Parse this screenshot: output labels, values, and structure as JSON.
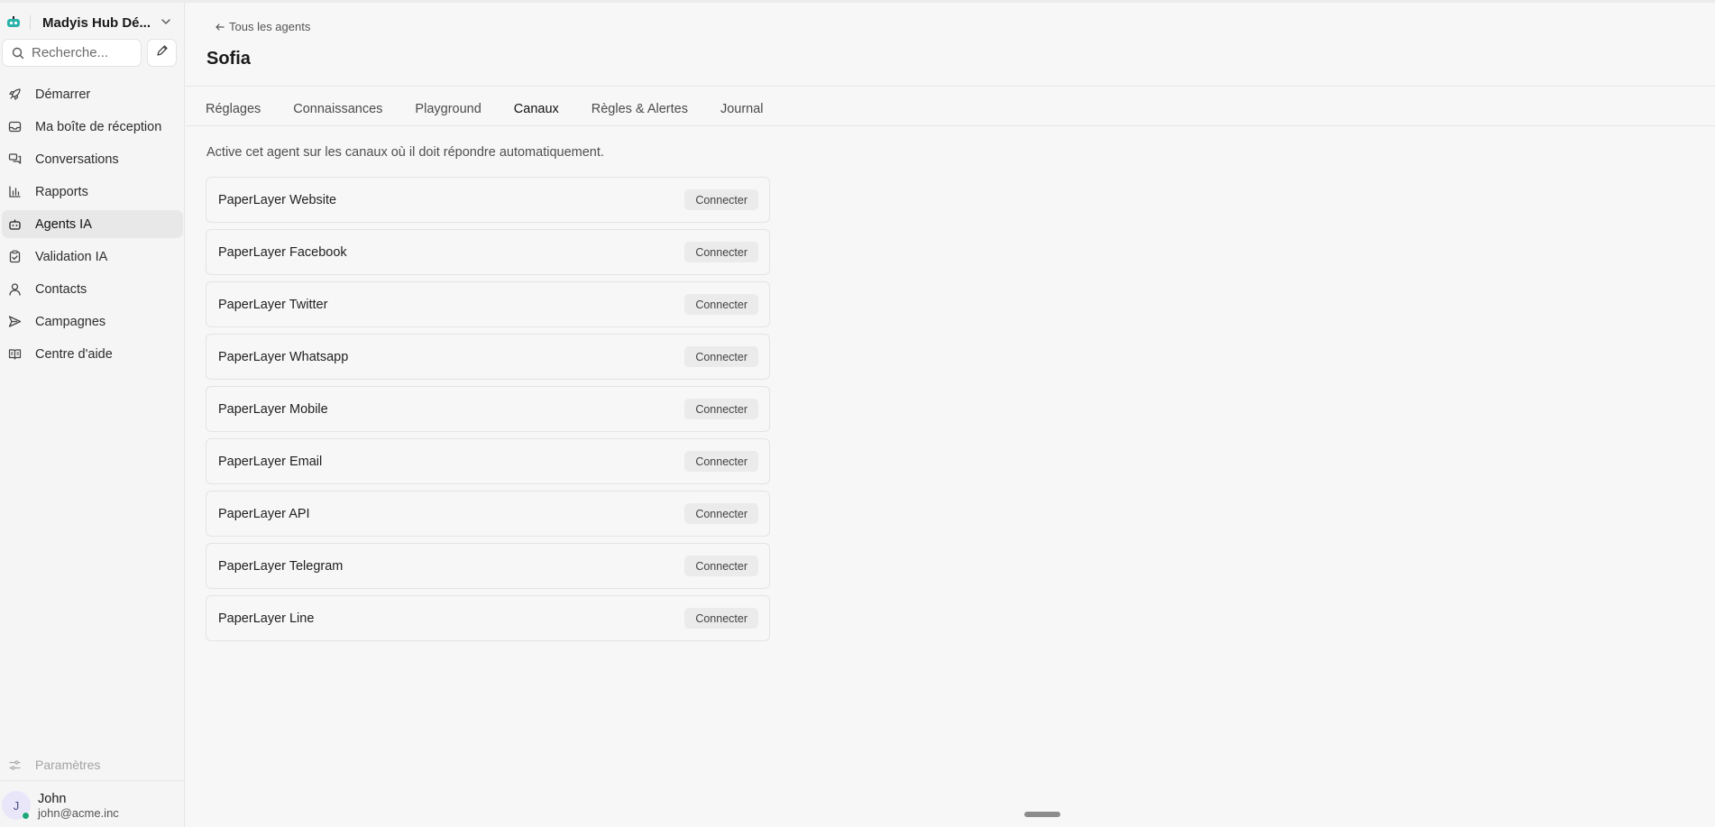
{
  "workspace": {
    "name": "Madyis Hub Dé..."
  },
  "search": {
    "placeholder": "Recherche..."
  },
  "sidebar": {
    "items": [
      {
        "label": "Démarrer",
        "icon": "rocket-icon"
      },
      {
        "label": "Ma boîte de réception",
        "icon": "inbox-icon"
      },
      {
        "label": "Conversations",
        "icon": "chat-icon"
      },
      {
        "label": "Rapports",
        "icon": "bar-chart-icon"
      },
      {
        "label": "Agents IA",
        "icon": "bot-icon",
        "active": true
      },
      {
        "label": "Validation IA",
        "icon": "clipboard-check-icon"
      },
      {
        "label": "Contacts",
        "icon": "user-icon"
      },
      {
        "label": "Campagnes",
        "icon": "send-icon"
      },
      {
        "label": "Centre d'aide",
        "icon": "book-icon"
      }
    ],
    "settings_label": "Paramètres"
  },
  "user": {
    "initial": "J",
    "name": "John",
    "email": "john@acme.inc"
  },
  "header": {
    "back_label": "Tous les agents",
    "title": "Sofia"
  },
  "tabs": [
    {
      "label": "Réglages"
    },
    {
      "label": "Connaissances"
    },
    {
      "label": "Playground"
    },
    {
      "label": "Canaux",
      "active": true
    },
    {
      "label": "Règles & Alertes"
    },
    {
      "label": "Journal"
    }
  ],
  "description": "Active cet agent sur les canaux où il doit répondre automatiquement.",
  "channels": [
    {
      "name": "PaperLayer Website",
      "action": "Connecter"
    },
    {
      "name": "PaperLayer Facebook",
      "action": "Connecter"
    },
    {
      "name": "PaperLayer Twitter",
      "action": "Connecter"
    },
    {
      "name": "PaperLayer Whatsapp",
      "action": "Connecter"
    },
    {
      "name": "PaperLayer Mobile",
      "action": "Connecter"
    },
    {
      "name": "PaperLayer Email",
      "action": "Connecter"
    },
    {
      "name": "PaperLayer API",
      "action": "Connecter"
    },
    {
      "name": "PaperLayer Telegram",
      "action": "Connecter"
    },
    {
      "name": "PaperLayer Line",
      "action": "Connecter"
    }
  ],
  "colors": {
    "status_online": "#1fa67a",
    "logo_teal": "#2bb3a8"
  }
}
